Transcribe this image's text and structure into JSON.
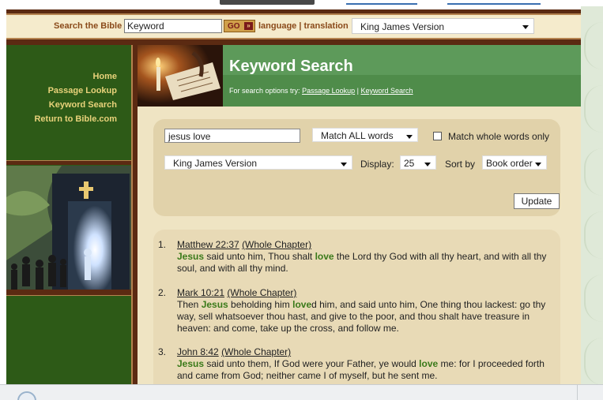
{
  "top_search": {
    "label": "Search the Bible",
    "keyword_value": "Keyword",
    "go_label": "GO",
    "go_arrow": "»",
    "lang_link": "language | translation",
    "translation_selected": "King James Version"
  },
  "nav": {
    "items": [
      "Home",
      "Passage Lookup",
      "Keyword Search",
      "Return to Bible.com"
    ]
  },
  "header": {
    "title": "Keyword Search",
    "options_prefix": "For search options try:",
    "link_passage": "Passage Lookup",
    "separator": "|",
    "link_keyword": "Keyword Search"
  },
  "search_form": {
    "query_value": "jesus love",
    "match_selected": "Match ALL words",
    "whole_words_label": "Match whole words only",
    "version_selected": "King James Version",
    "display_label": "Display:",
    "display_selected": "25",
    "sort_label": "Sort by",
    "sort_selected": "Book order",
    "update_label": "Update"
  },
  "results": [
    {
      "num": "1.",
      "ref": "Matthew 22:37",
      "chapter": "(Whole Chapter)",
      "segments": [
        {
          "t": "Jesus",
          "hl": true
        },
        {
          "t": " said unto him, Thou shalt ",
          "hl": false
        },
        {
          "t": "love",
          "hl": true
        },
        {
          "t": " the Lord thy God with all thy heart, and with all thy soul, and with all thy mind.",
          "hl": false
        }
      ]
    },
    {
      "num": "2.",
      "ref": "Mark 10:21",
      "chapter": "(Whole Chapter)",
      "segments": [
        {
          "t": "Then ",
          "hl": false
        },
        {
          "t": "Jesus",
          "hl": true
        },
        {
          "t": " beholding him ",
          "hl": false
        },
        {
          "t": "love",
          "hl": true
        },
        {
          "t": "d him, and said unto him, One thing thou lackest: go thy way, sell whatsoever thou hast, and give to the poor, and thou shalt have treasure in heaven: and come, take up the cross, and follow me.",
          "hl": false
        }
      ]
    },
    {
      "num": "3.",
      "ref": "John 8:42",
      "chapter": "(Whole Chapter)",
      "segments": [
        {
          "t": "Jesus",
          "hl": true
        },
        {
          "t": " said unto them, If God were your Father, ye would ",
          "hl": false
        },
        {
          "t": "love",
          "hl": true
        },
        {
          "t": " me: for I proceeded forth and came from God; neither came I of myself, but he sent me.",
          "hl": false
        }
      ]
    }
  ],
  "colors": {
    "nav_text": "#e8d27a",
    "header_green": "#5d9a5a",
    "highlight_green": "#3a7a1a",
    "brown_bar": "#5b2a12"
  }
}
